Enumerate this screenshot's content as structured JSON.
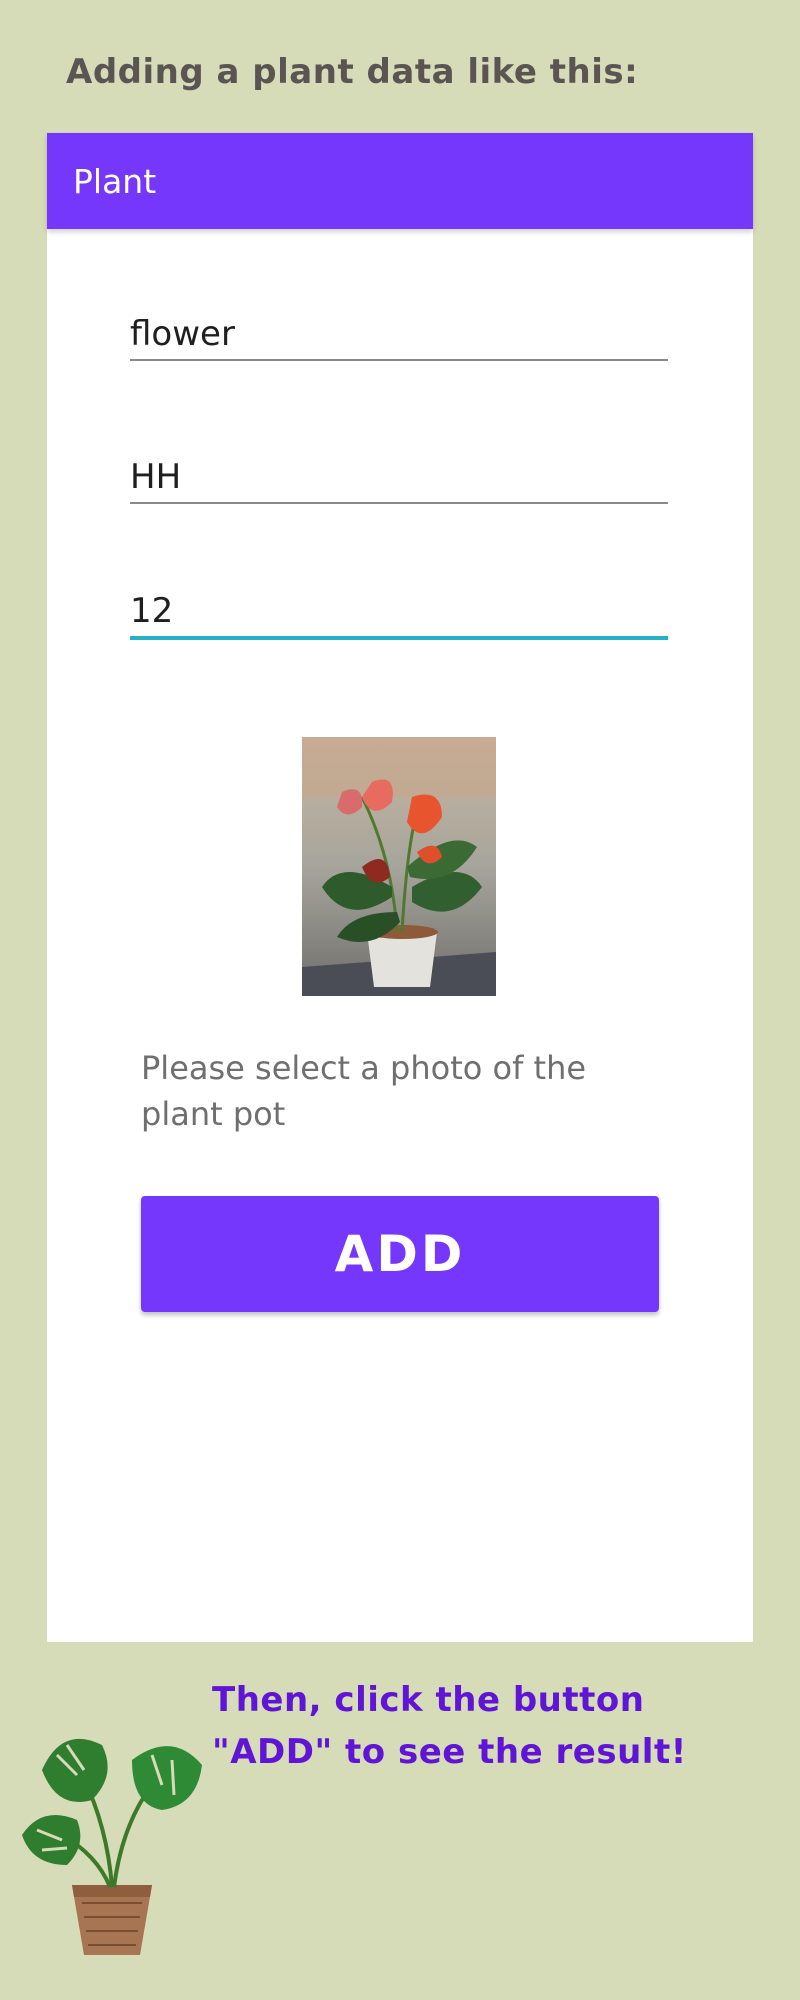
{
  "heading": "Adding a plant data like this:",
  "app": {
    "title": "Plant",
    "fields": [
      {
        "value": "flower"
      },
      {
        "value": "HH"
      },
      {
        "value": "12"
      }
    ],
    "photo_hint": "Please select a photo of the plant pot",
    "add_button": "ADD"
  },
  "footer": {
    "line1": "Then, click the button",
    "line2": "\"ADD\" to see the result!"
  },
  "colors": {
    "background": "#d6dbb8",
    "accent": "#7537fb",
    "focus_underline": "#26b0c6",
    "footer_text": "#5f14d6"
  },
  "icons": [
    "plant-photo",
    "monstera-plant-icon"
  ]
}
